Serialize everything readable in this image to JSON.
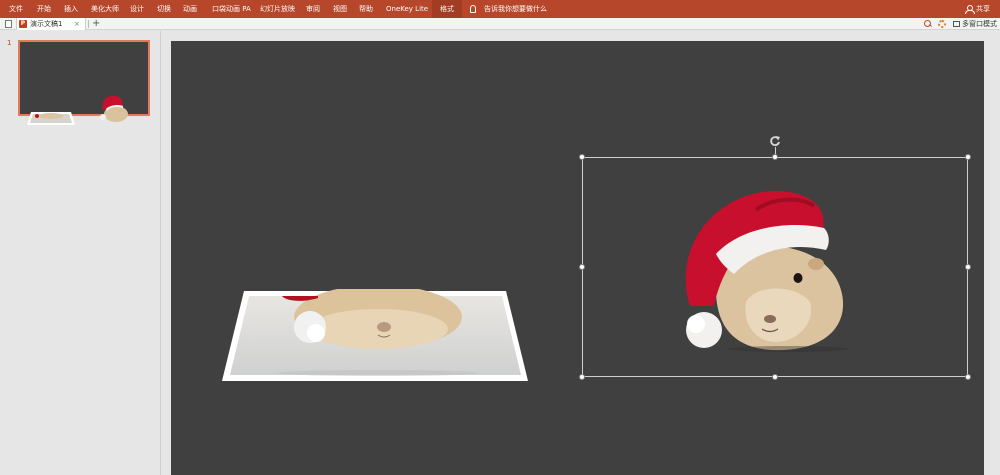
{
  "ribbon": {
    "tabs": [
      "文件",
      "开始",
      "插入",
      "美化大师",
      "设计",
      "切换",
      "动画",
      "口袋动画 PA",
      "幻灯片放映",
      "审阅",
      "视图",
      "帮助",
      "OneKey Lite",
      "格式"
    ],
    "active_tab": "格式",
    "tell_me": "告诉我你想要做什么",
    "share_label": "共享"
  },
  "tabbar": {
    "doc_title": "演示文稿1",
    "close": "×",
    "add": "+",
    "multi_window": "多窗口模式"
  },
  "slides": {
    "current_number": "1"
  },
  "colors": {
    "ribbon": "#b7472a",
    "canvas": "#404040",
    "thumb_border": "#e07b5c",
    "hat_red": "#c8102e"
  },
  "icons": [
    "lightbulb-icon",
    "person-icon",
    "document-icon",
    "powerpoint-icon",
    "zoom-icon",
    "gear-icon",
    "window-icon",
    "rotate-icon"
  ]
}
